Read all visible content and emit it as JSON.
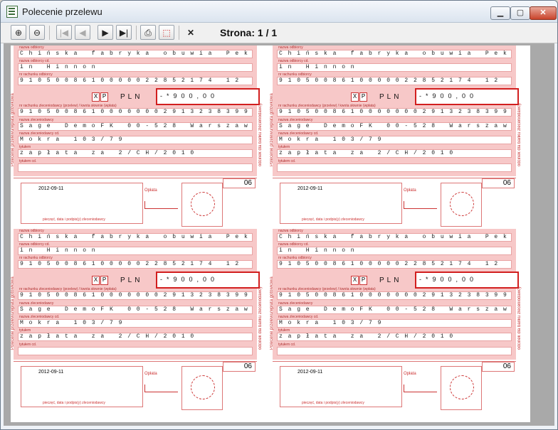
{
  "window": {
    "title": "Polecenie przelewu"
  },
  "toolbar": {
    "page_info": "Strona: 1 / 1"
  },
  "form": {
    "recipient_name": "Chińska fabryka obuwia Pek",
    "recipient_city": "in Hinnon",
    "recipient_account": "9105008610000022852174 12",
    "currency": "PLN",
    "amount": "-*900,00",
    "sender_account": "91050086100000002913238399",
    "sender_name": "Sage DemoFK 00-528 Warszawa",
    "sender_street": "Mokra 103/79",
    "title_line": "zapłata za 2/CH/2010",
    "date": "2012-09-11",
    "copy_number": "06",
    "podpis_label": "Opłata",
    "footer_label": "pieczęć, data i podpis(y) zleceniodawcy",
    "side_left": "Polecenie przelewu/wpłata gotówkowa",
    "side_right": "odcinek dla banku zleceniodawcy"
  }
}
